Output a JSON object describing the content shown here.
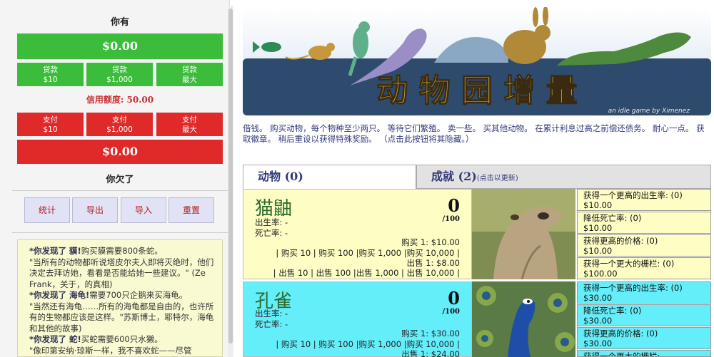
{
  "left": {
    "you_have": "你有",
    "money": "$0.00",
    "loan_buttons": [
      {
        "title": "贷款",
        "amount": "$10"
      },
      {
        "title": "贷款",
        "amount": "$1,000"
      },
      {
        "title": "贷款",
        "amount": "最大"
      }
    ],
    "credit": "信用额度: 50.00",
    "pay_buttons": [
      {
        "title": "支付",
        "amount": "$10"
      },
      {
        "title": "支付",
        "amount": "$1,000"
      },
      {
        "title": "支付",
        "amount": "最大"
      }
    ],
    "debt": "$0.00",
    "you_owe": "你欠了",
    "actions": [
      "统计",
      "导出",
      "导入",
      "重置"
    ],
    "story": [
      {
        "found": "*你发现了 貘!",
        "text": "购买貘需要800条蛇。"
      },
      {
        "found": "",
        "text": "\"当所有的动物都听说塔皮尔夫人即将灭绝时，他们决定去拜访她，看看是否能给她一些建议。\" (Ze Frank，关于，的真相)"
      },
      {
        "found": "*你发现了 海龟!",
        "text": "需要700只企鹅来买海龟。"
      },
      {
        "found": "",
        "text": "\"当然还有海龟……所有的海龟都是自由的，也许所有的生物都应该是这样。\"苏斯博士，耶特尔，海龟和其他的故事)"
      },
      {
        "found": "*你发现了 蛇!",
        "text": "买蛇需要600只水獭。"
      },
      {
        "found": "",
        "text": "\"像印第安纳·琼斯一样，我不喜欢蛇——尽管"
      }
    ]
  },
  "banner": {
    "title": "动 物 园 增 量",
    "subtitle": "an idle game by Ximenez"
  },
  "description": "借钱。 购买动物，每个物种至少两只。 等待它们繁殖。 卖一些。 买其他动物。 在累计利息过高之前偿还债务。 耐心一点。 获取徽章。 稍后重设以获得特殊奖励。 （点击此按钮将其隐藏。）",
  "tabs": {
    "animals": "动物 (0)",
    "achievements": "成就 (2)",
    "achievements_hint": "(点击以更新)"
  },
  "animals": [
    {
      "name": "猫鼬",
      "birth_rate": "出生率:  -",
      "death_rate": "死亡率:  -",
      "count": "0",
      "per": "/100",
      "buy1": "购买 1: $10.00",
      "buy_more": "| 购买 10 | 购买 100 |购买 1,000 |购买 10,000 |",
      "sell1": "出售 1: $8.00",
      "sell_more": "| 出售 10 | 出售 100 |出售 1,000 | 出售 10,000 |",
      "upgrades": [
        {
          "label": "获得一个更高的出生率: (0)",
          "price": "$10.00"
        },
        {
          "label": "降低死亡率: (0)",
          "price": "$10.00"
        },
        {
          "label": "获得更高的价格: (0)",
          "price": "$10.00"
        },
        {
          "label": "获得一个更大的栅栏: (0)",
          "price": "$100.00"
        }
      ]
    },
    {
      "name": "孔雀",
      "birth_rate": "出生率:  -",
      "death_rate": "死亡率:  -",
      "count": "0",
      "per": "/100",
      "buy1": "购买 1: $30.00",
      "buy_more": "| 购买 10 | 购买 100 |购买 1,000 |购买 10,000 |",
      "sell1": "出售 1: $24.00",
      "sell_more": "",
      "upgrades": [
        {
          "label": "获得一个更高的出生率: (0)",
          "price": "$30.00"
        },
        {
          "label": "降低死亡率: (0)",
          "price": "$30.00"
        },
        {
          "label": "获得更高的价格: (0)",
          "price": "$30.00"
        },
        {
          "label": "获得一个更大的栅栏:",
          "price": ""
        }
      ]
    }
  ],
  "colors": {
    "green": "#3bbd3b",
    "red": "#e02a2a",
    "card1": "#fdfdc4",
    "card2": "#64eefa"
  }
}
